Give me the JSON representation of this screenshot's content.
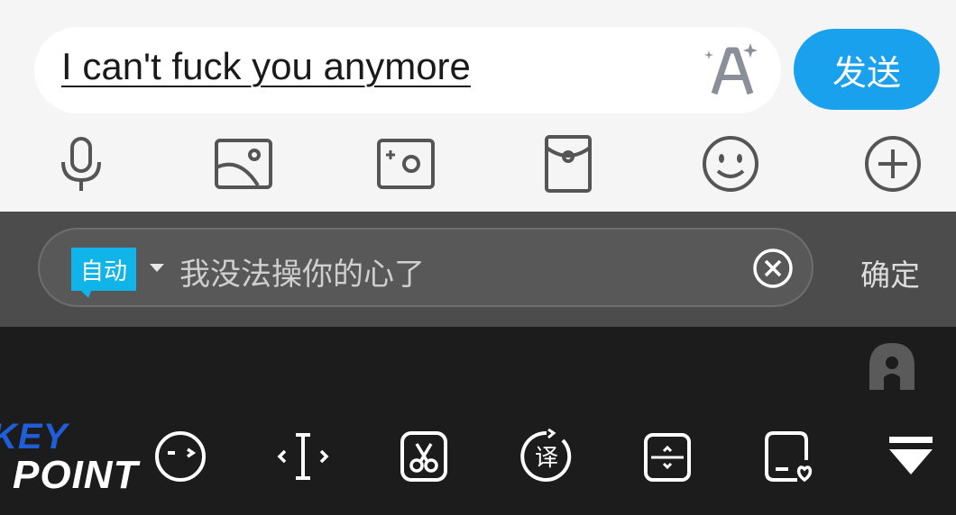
{
  "composer": {
    "message_text": "I can't fuck you anymore",
    "send_label": "发送"
  },
  "toolbar_icons": [
    "microphone-icon",
    "image-icon",
    "camera-icon",
    "red-envelope-icon",
    "emoji-icon",
    "plus-icon"
  ],
  "translation": {
    "mode_label": "自动",
    "translated_text": "我没法操你的心了",
    "confirm_label": "确定"
  },
  "keyboard_toolbar_icons": [
    "sticker-face-icon",
    "cursor-move-icon",
    "clipboard-icon",
    "translate-icon",
    "keyboard-resize-icon",
    "note-icon",
    "collapse-keyboard-icon"
  ],
  "watermark": {
    "line1": "KEY",
    "line2": "POINT"
  },
  "colors": {
    "send_button": "#1aa1ee",
    "auto_badge": "#11b4e8",
    "keyboard_bg": "#1c1c1c",
    "translate_bar_bg": "#4c4c4c",
    "watermark_key": "#1f5ed8"
  }
}
